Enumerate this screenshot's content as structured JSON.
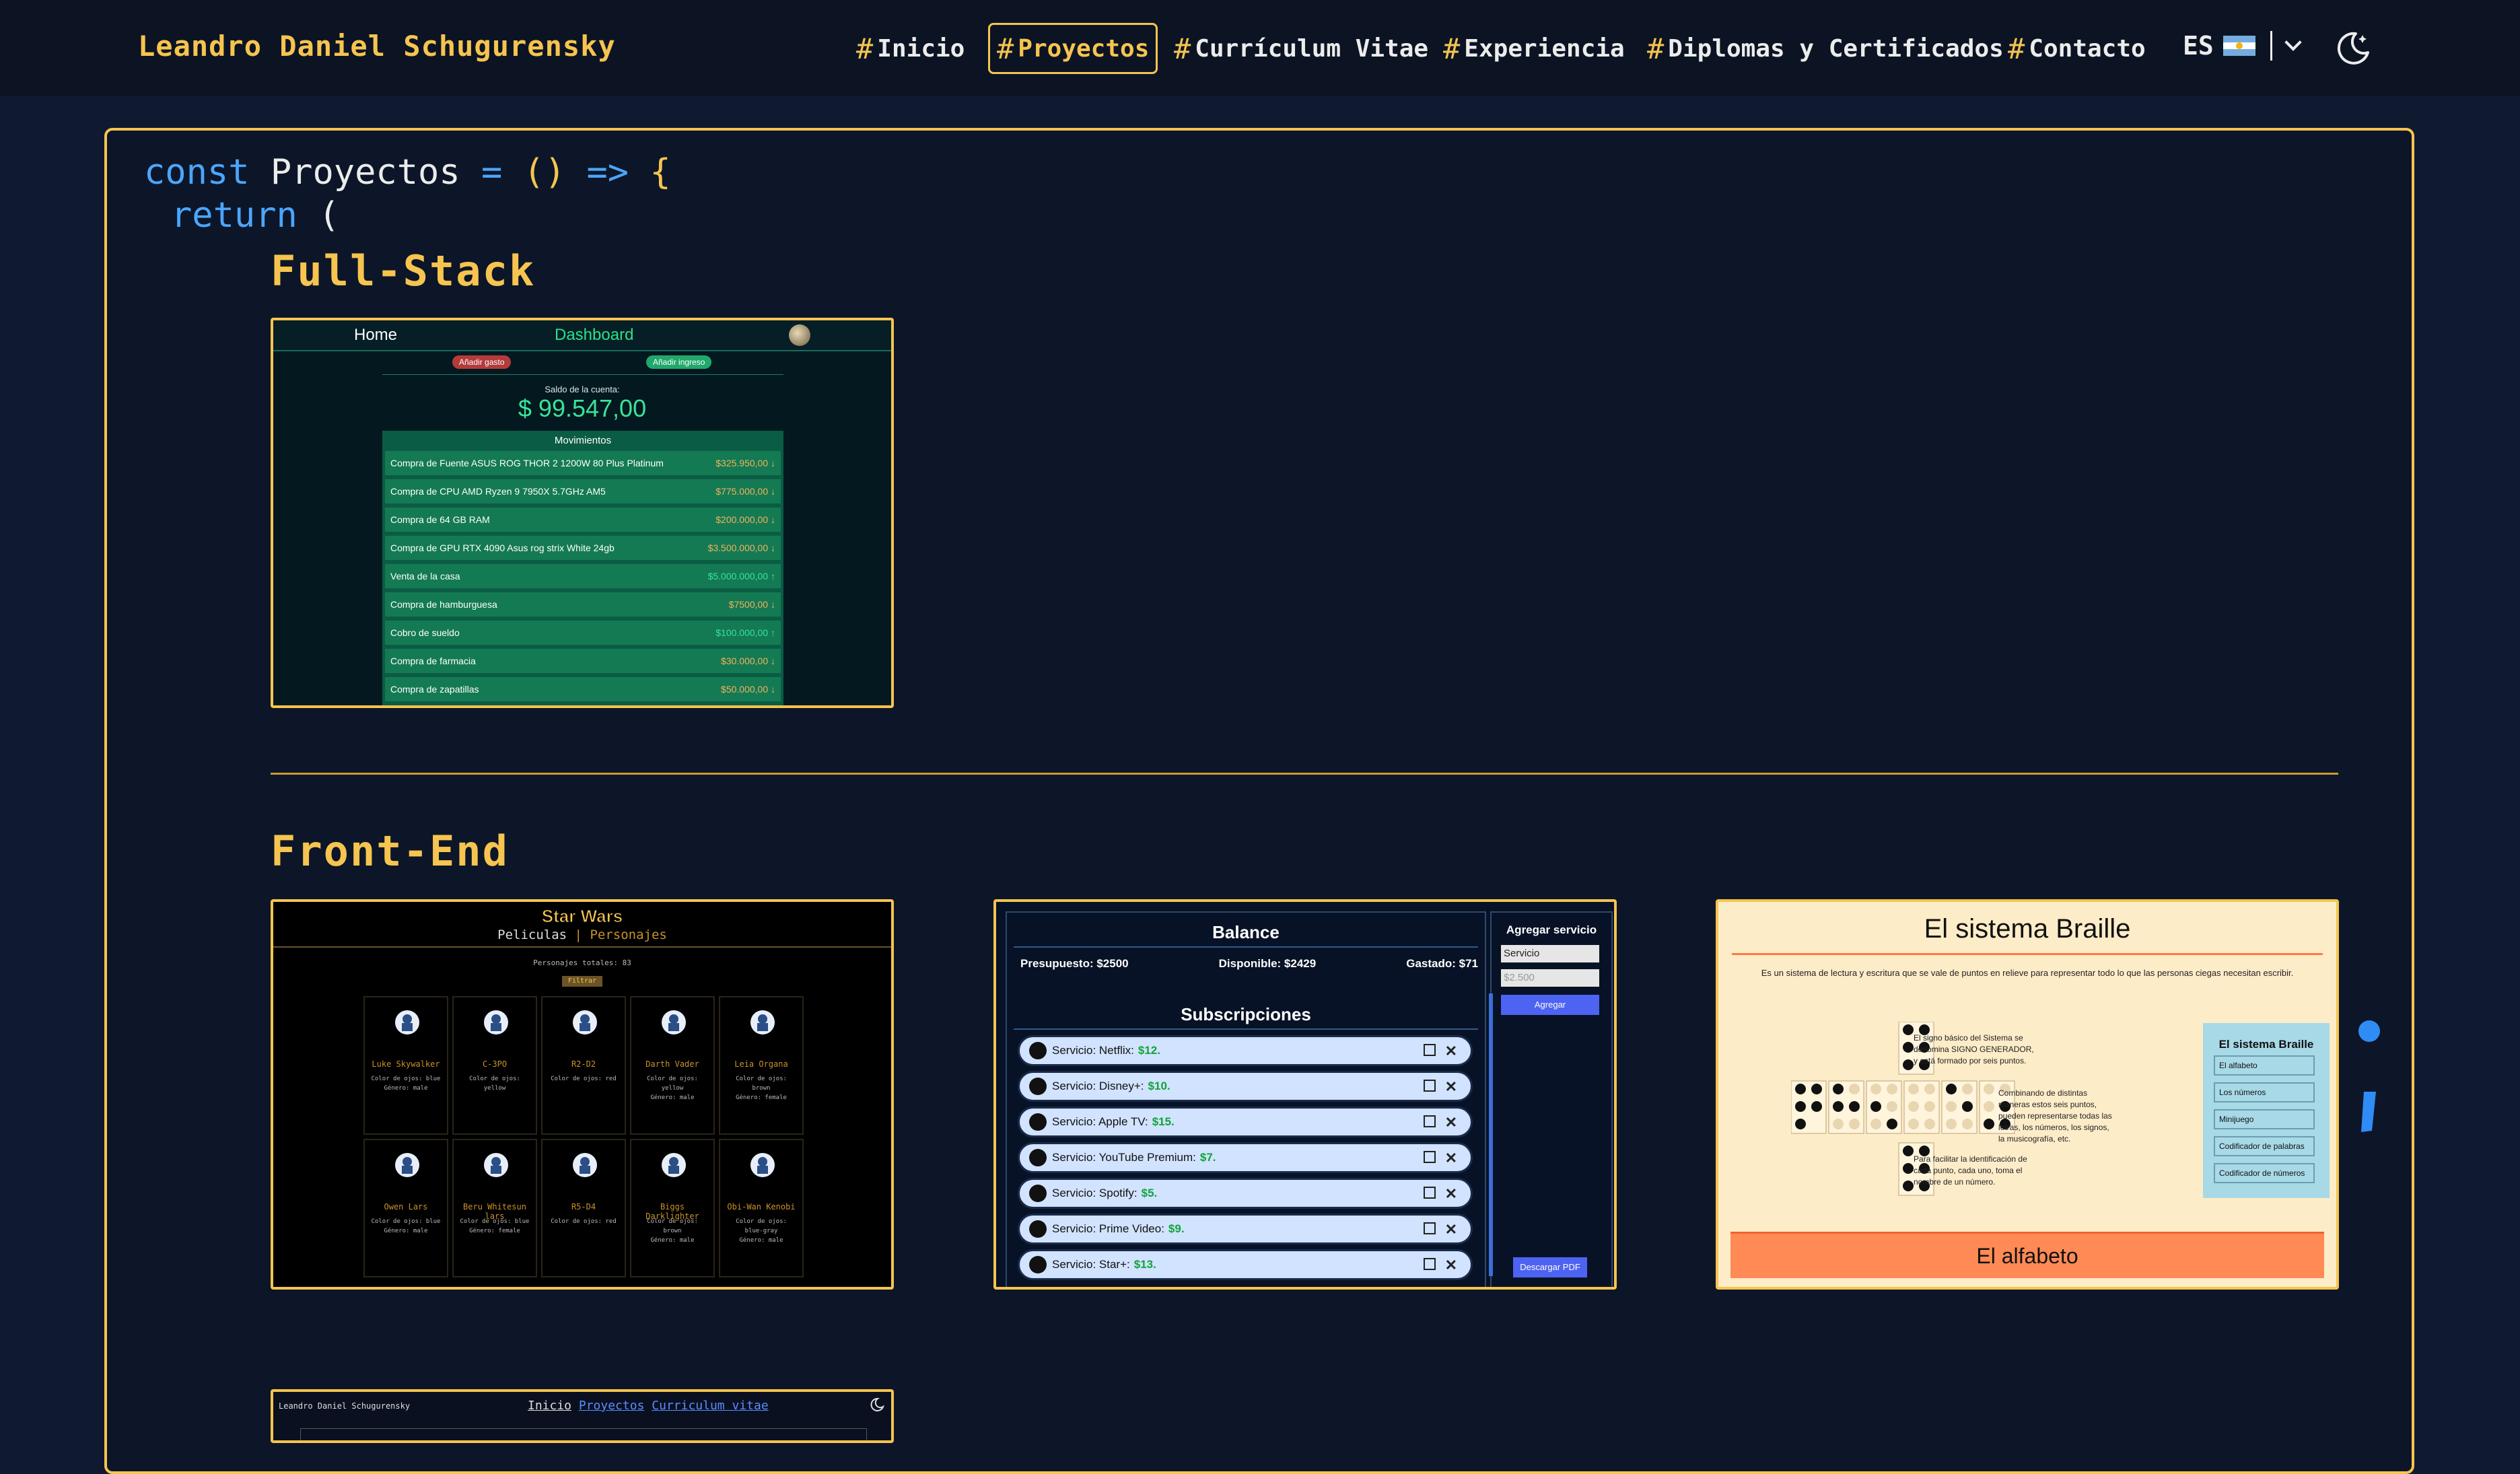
{
  "nav": {
    "brand": "Leandro Daniel Schugurensky",
    "hash": "#",
    "items": [
      {
        "label": "Inicio",
        "active": false
      },
      {
        "label": "Proyectos",
        "active": true
      },
      {
        "label": "Currículum Vitae",
        "active": false
      },
      {
        "label": "Experiencia",
        "active": false
      },
      {
        "label": "Diplomas y Certificados",
        "active": false
      },
      {
        "label": "Contacto",
        "active": false
      }
    ],
    "language": "ES",
    "theme_icon": "moon-icon"
  },
  "code": {
    "line1": {
      "const": "const",
      "name": "Proyectos",
      "eq": "=",
      "parens": "()",
      "arrow": "=>",
      "brace": "{"
    },
    "line2": {
      "return": "return",
      "paren": "("
    }
  },
  "sections": {
    "fullstack": "Full-Stack",
    "frontend": "Front-End"
  },
  "projects": {
    "finance": {
      "home": "Home",
      "dashboard": "Dashboard",
      "add_expense": "Añadir gasto",
      "add_income": "Añadir ingreso",
      "balance_label": "Saldo de la cuenta:",
      "balance": "$ 99.547,00",
      "movements_title": "Movimientos",
      "movements": [
        {
          "desc": "Compra de Fuente ASUS ROG THOR 2 1200W 80 Plus Platinum",
          "amount": "$325.950,00 ↓",
          "type": "out"
        },
        {
          "desc": "Compra de CPU AMD Ryzen 9 7950X 5.7GHz AM5",
          "amount": "$775.000,00 ↓",
          "type": "out"
        },
        {
          "desc": "Compra de 64 GB RAM",
          "amount": "$200.000,00 ↓",
          "type": "out"
        },
        {
          "desc": "Compra de GPU RTX 4090 Asus rog strix White 24gb",
          "amount": "$3.500.000,00 ↓",
          "type": "out"
        },
        {
          "desc": "Venta de la casa",
          "amount": "$5.000.000,00 ↑",
          "type": "in"
        },
        {
          "desc": "Compra de hamburguesa",
          "amount": "$7500,00 ↓",
          "type": "out"
        },
        {
          "desc": "Cobro de sueldo",
          "amount": "$100.000,00 ↑",
          "type": "in"
        },
        {
          "desc": "Compra de farmacia",
          "amount": "$30.000,00 ↓",
          "type": "out"
        },
        {
          "desc": "Compra de zapatillas",
          "amount": "$50.000,00 ↓",
          "type": "out"
        }
      ]
    },
    "starwars": {
      "title": "Star Wars",
      "tab1": "Peliculas",
      "sep": "|",
      "tab2": "Personajes",
      "total": "Personajes totales: 83",
      "filter": "Filtrar",
      "characters": [
        {
          "name": "Luke Skywalker",
          "desc": "Color de ojos: blue\nGénero: male"
        },
        {
          "name": "C-3PO",
          "desc": "Color de ojos:\nyellow"
        },
        {
          "name": "R2-D2",
          "desc": "Color de ojos: red"
        },
        {
          "name": "Darth Vader",
          "desc": "Color de ojos:\nyellow\nGénero: male"
        },
        {
          "name": "Leia Organa",
          "desc": "Color de ojos:\nbrown\nGénero: female"
        },
        {
          "name": "Owen Lars",
          "desc": "Color de ojos: blue\nGénero: male"
        },
        {
          "name": "Beru Whitesun lars",
          "desc": "Color de ojos: blue\nGénero: female"
        },
        {
          "name": "R5-D4",
          "desc": "Color de ojos: red"
        },
        {
          "name": "Biggs Darklighter",
          "desc": "Color de ojos:\nbrown\nGénero: male"
        },
        {
          "name": "Obi-Wan Kenobi",
          "desc": "Color de ojos:\nblue-gray\nGénero: male"
        }
      ]
    },
    "budget": {
      "balance_title": "Balance",
      "budget": "Presupuesto: $2500",
      "available": "Disponible: $2429",
      "spent": "Gastado: $71",
      "subs_title": "Subscripciones",
      "services": [
        {
          "label": "Servicio: Netflix:",
          "price": "$12."
        },
        {
          "label": "Servicio: Disney+:",
          "price": "$10."
        },
        {
          "label": "Servicio: Apple TV:",
          "price": "$15."
        },
        {
          "label": "Servicio: YouTube Premium:",
          "price": "$7."
        },
        {
          "label": "Servicio: Spotify:",
          "price": "$5."
        },
        {
          "label": "Servicio: Prime Video:",
          "price": "$9."
        },
        {
          "label": "Servicio: Star+:",
          "price": "$13."
        }
      ],
      "add_title": "Agregar servicio",
      "select_value": "Servicio",
      "input_placeholder": "$2.500",
      "add_button": "Agregar",
      "pdf_button": "Descargar PDF"
    },
    "braille": {
      "title": "El sistema Braille",
      "description": "Es un sistema de lectura y escritura que se vale de puntos en relieve para representar todo lo que las personas ciegas necesitan escribir.",
      "text1": "El signo básico del Sistema se denomina SIGNO GENERADOR, y está formado por seis puntos.",
      "text2": "Combinando de distintas maneras estos seis puntos, pueden representarse todas las letras, los números, los signos, la musicografía, etc.",
      "text3": "Para facilitar la identificación de cada punto, cada uno, toma el nombre de un número.",
      "menu_title": "El sistema Braille",
      "menu_items": [
        "El alfabeto",
        "Los números",
        "Minijuego",
        "Codificador de palabras",
        "Codificador de números"
      ],
      "footer": "El alfabeto"
    },
    "portfolio": {
      "brand": "Leandro Daniel Schugurensky",
      "nav1": "Inicio",
      "nav2": "Proyectos",
      "nav3": "Curriculum vitae"
    }
  },
  "colors": {
    "accent": "#f6c44f",
    "background": "#0f1a30",
    "keyword": "#4aa6ff"
  }
}
